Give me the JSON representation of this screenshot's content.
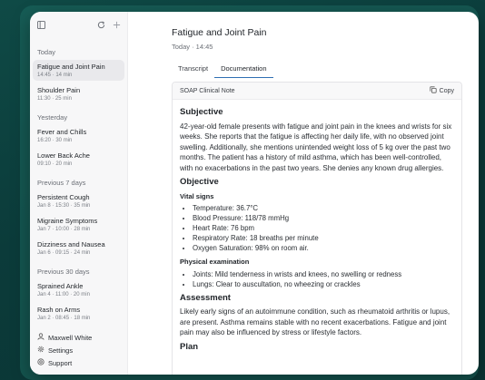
{
  "sidebar": {
    "sections": [
      {
        "label": "Today",
        "items": [
          {
            "title": "Fatigue and Joint Pain",
            "sub": "14:45 · 14 min",
            "active": true
          },
          {
            "title": "Shoulder Pain",
            "sub": "11:30 · 25 min"
          }
        ]
      },
      {
        "label": "Yesterday",
        "items": [
          {
            "title": "Fever and Chills",
            "sub": "16:20 · 30 min"
          },
          {
            "title": "Lower Back Ache",
            "sub": "09:10 · 20 min"
          }
        ]
      },
      {
        "label": "Previous 7 days",
        "items": [
          {
            "title": "Persistent Cough",
            "sub": "Jan 8 · 15:30 · 35 min"
          },
          {
            "title": "Migraine Symptoms",
            "sub": "Jan 7 · 10:00 · 28 min"
          },
          {
            "title": "Dizziness and Nausea",
            "sub": "Jan 6 · 09:15 · 24 min"
          }
        ]
      },
      {
        "label": "Previous 30 days",
        "items": [
          {
            "title": "Sprained Ankle",
            "sub": "Jan 4 · 11:00 · 20 min"
          },
          {
            "title": "Rash on Arms",
            "sub": "Jan 2 · 08:45 · 18 min"
          }
        ]
      }
    ],
    "footer": {
      "user": "Maxwell White",
      "settings": "Settings",
      "support": "Support"
    },
    "icons": [
      "sidebar-toggle-icon",
      "refresh-icon",
      "plus-icon"
    ]
  },
  "main": {
    "title": "Fatigue and Joint Pain",
    "subtitle": "Today · 14:45",
    "tabs": [
      {
        "label": "Transcript"
      },
      {
        "label": "Documentation",
        "active": true
      }
    ],
    "doc": {
      "header": "SOAP Clinical Note",
      "copy_label": "Copy",
      "subjective_heading": "Subjective",
      "subjective_text": "42-year-old female presents with fatigue and joint pain in the knees and wrists for six weeks. She reports that the fatigue is affecting her daily life, with no observed joint swelling. Additionally, she mentions unintended weight loss of 5 kg over the past two months. The patient has a history of mild asthma, which has been well-controlled, with no exacerbations in the past two years. She denies any known drug allergies.",
      "objective_heading": "Objective",
      "vitals_heading": "Vital signs",
      "vitals": [
        "Temperature: 36.7°C",
        "Blood Pressure: 118/78 mmHg",
        "Heart Rate: 76 bpm",
        "Respiratory Rate: 18 breaths per minute",
        "Oxygen Saturation: 98% on room air."
      ],
      "exam_heading": "Physical examination",
      "exam": [
        "Joints: Mild tenderness in wrists and knees, no swelling or redness",
        "Lungs: Clear to auscultation, no wheezing or crackles"
      ],
      "assessment_heading": "Assessment",
      "assessment_text": "Likely early signs of an autoimmune condition, such as rheumatoid arthritis or lupus, are present. Asthma remains stable with no recent exacerbations. Fatigue and joint pain may also be influenced by stress or lifestyle factors.",
      "plan_heading": "Plan"
    }
  }
}
